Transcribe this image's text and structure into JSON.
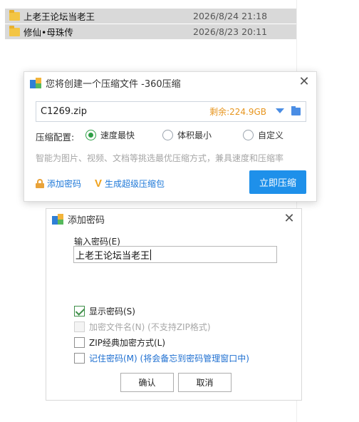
{
  "file_list": [
    {
      "name": "上老王论坛当老王",
      "date": "2026/8/24 21:18"
    },
    {
      "name": "修仙•母珠传",
      "date": "2026/8/23 20:11"
    }
  ],
  "compress_dialog": {
    "title": "您将创建一个压缩文件 -360压缩",
    "filename": "C1269.zip",
    "space_left": "剩余:224.9GB",
    "config_label": "压缩配置:",
    "options": [
      {
        "label": "速度最快",
        "checked": true
      },
      {
        "label": "体积最小",
        "checked": false
      },
      {
        "label": "自定义",
        "checked": false
      }
    ],
    "hint": "智能为图片、视频、文档等挑选最优压缩方式，兼具速度和压缩率",
    "add_password_link": "添加密码",
    "super_compress_link": "生成超级压缩包",
    "compress_button": "立即压缩"
  },
  "password_dialog": {
    "title": "添加密码",
    "input_label": "输入密码(E)",
    "password_value": "上老王论坛当老王",
    "checkboxes": [
      {
        "label": "显示密码(S)",
        "checked": true,
        "enabled": true
      },
      {
        "label": "加密文件名(N) (不支持ZIP格式)",
        "checked": false,
        "enabled": false
      },
      {
        "label": "ZIP经典加密方式(L)",
        "checked": false,
        "enabled": true
      },
      {
        "label": "记住密码(M) (将会备忘到密码管理窗口中)",
        "checked": false,
        "enabled": true
      }
    ],
    "ok_button": "确认",
    "cancel_button": "取消"
  },
  "colors": {
    "accent_blue": "#1e90ea",
    "radio_green": "#2e9f46",
    "space_orange": "#e7951e"
  }
}
